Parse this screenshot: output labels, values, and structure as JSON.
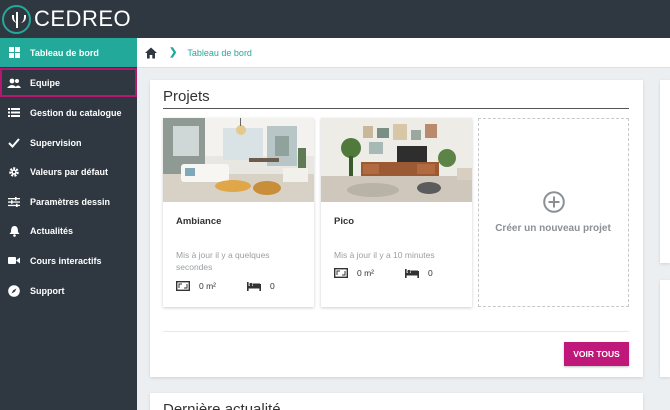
{
  "app": {
    "logo_text": "CEDREO"
  },
  "sidebar": {
    "items": [
      {
        "label": "Tableau de bord",
        "icon": "dashboard-icon"
      },
      {
        "label": "Equipe",
        "icon": "team-icon"
      },
      {
        "label": "Gestion du catalogue",
        "icon": "list-icon"
      },
      {
        "label": "Supervision",
        "icon": "check-icon"
      },
      {
        "label": "Valeurs par défaut",
        "icon": "gear-icon"
      },
      {
        "label": "Paramètres dessin",
        "icon": "sliders-icon"
      },
      {
        "label": "Actualités",
        "icon": "bell-icon"
      },
      {
        "label": "Cours interactifs",
        "icon": "video-icon"
      },
      {
        "label": "Support",
        "icon": "compass-icon"
      }
    ],
    "active_index": 0,
    "highlighted_index": 1
  },
  "breadcrumb": {
    "home_icon": "home-icon",
    "current": "Tableau de bord"
  },
  "projects": {
    "title": "Projets",
    "items": [
      {
        "name": "Ambiance",
        "updated": "Mis à jour il y a quelques secondes",
        "area": "0 m²",
        "bedrooms": "0"
      },
      {
        "name": "Pico",
        "updated": "Mis à jour il y a 10 minutes",
        "area": "0 m²",
        "bedrooms": "0"
      }
    ],
    "new_project_label": "Créer un nouveau projet",
    "view_all_label": "VOIR TOUS"
  },
  "news": {
    "title": "Dernière actualité"
  },
  "colors": {
    "accent": "#22a99a",
    "primary_button": "#c0177a",
    "sidebar_bg": "#2f3740",
    "highlight": "#b5176e"
  }
}
